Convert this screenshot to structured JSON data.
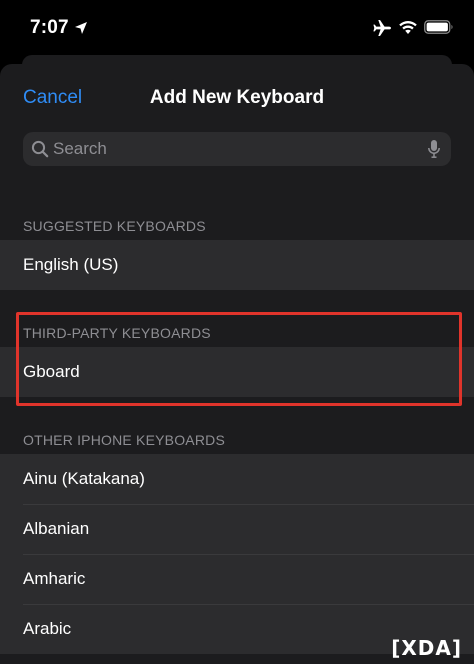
{
  "status_bar": {
    "time": "7:07"
  },
  "nav": {
    "cancel_label": "Cancel",
    "title": "Add New Keyboard"
  },
  "search": {
    "placeholder": "Search"
  },
  "sections": {
    "suggested": {
      "header": "SUGGESTED KEYBOARDS",
      "items": [
        "English (US)"
      ]
    },
    "third_party": {
      "header": "THIRD-PARTY KEYBOARDS",
      "items": [
        "Gboard"
      ]
    },
    "other": {
      "header": "OTHER IPHONE KEYBOARDS",
      "items": [
        "Ainu (Katakana)",
        "Albanian",
        "Amharic",
        "Arabic"
      ]
    }
  },
  "watermark": "XDA",
  "colors": {
    "accent": "#2f8cf5",
    "highlight": "#e0342b",
    "background": "#1c1c1e"
  }
}
